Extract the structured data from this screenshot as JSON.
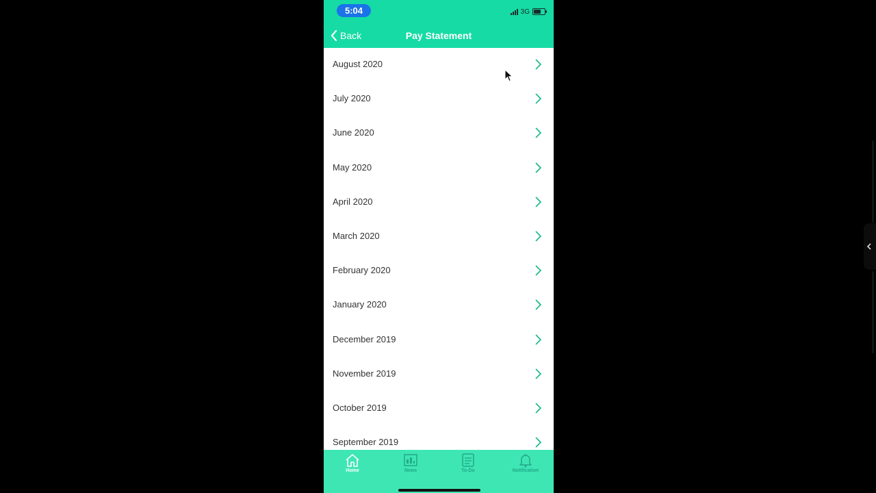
{
  "status_bar": {
    "time": "5:04",
    "network": "3G"
  },
  "header": {
    "back_label": "Back",
    "title": "Pay Statement"
  },
  "statements": [
    {
      "label": "August 2020"
    },
    {
      "label": "July 2020"
    },
    {
      "label": "June 2020"
    },
    {
      "label": "May 2020"
    },
    {
      "label": "April 2020"
    },
    {
      "label": "March 2020"
    },
    {
      "label": "February 2020"
    },
    {
      "label": "January 2020"
    },
    {
      "label": "December 2019"
    },
    {
      "label": "November 2019"
    },
    {
      "label": "October 2019"
    },
    {
      "label": "September 2019"
    }
  ],
  "tabs": [
    {
      "label": "Home",
      "icon": "home-icon",
      "active": true
    },
    {
      "label": "News",
      "icon": "news-icon",
      "active": false
    },
    {
      "label": "To-Do",
      "icon": "todo-icon",
      "active": false
    },
    {
      "label": "Notification",
      "icon": "bell-icon",
      "active": false
    }
  ],
  "colors": {
    "header": "#16dba4",
    "tabbar": "#3ee6b4",
    "chevron": "#16b88a",
    "time_pill": "#1a73e8"
  }
}
